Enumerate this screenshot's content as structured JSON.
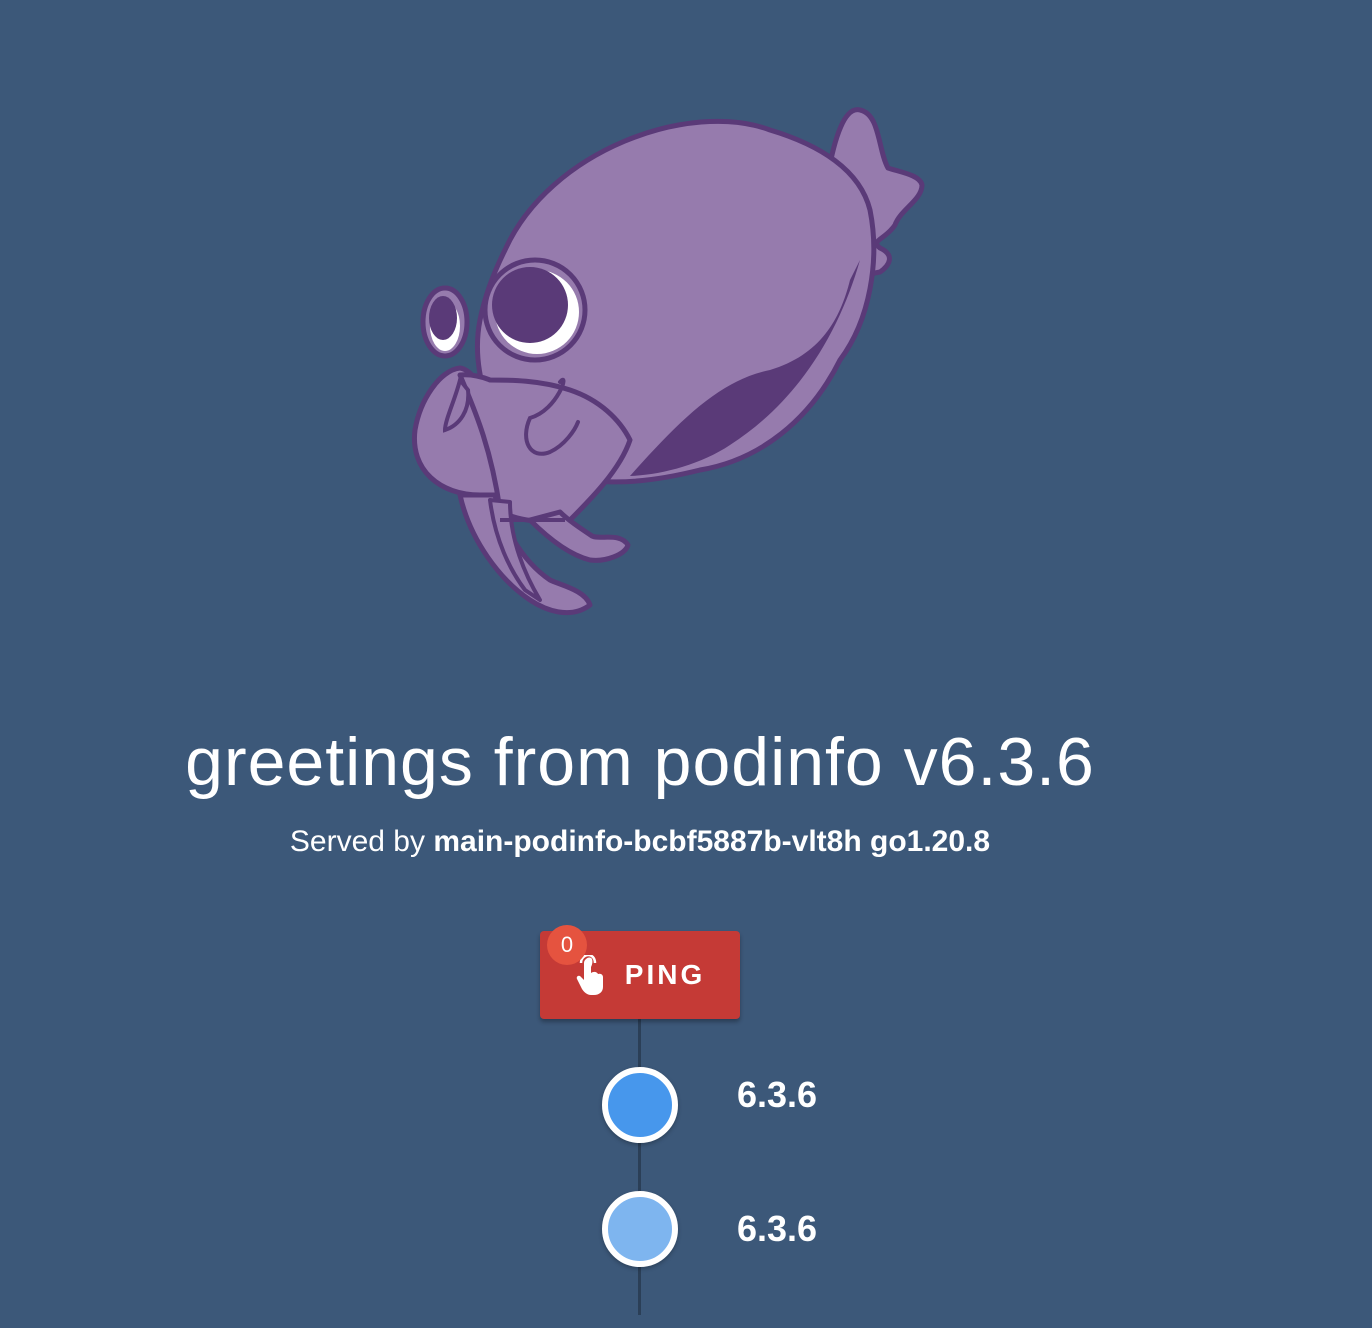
{
  "mascot": {
    "icon": "cuttlefish-mascot-icon",
    "body_color": "#967bad",
    "outline_color": "#5a3a78"
  },
  "greeting": {
    "text": "greetings from podinfo v6.3.6"
  },
  "served_by": {
    "prefix": "Served by",
    "host": "main-podinfo-bcbf5887b-vlt8h go1.20.8"
  },
  "ping": {
    "label": "PING",
    "count": "0",
    "icon": "touch-hand-icon",
    "color": "#c53a36",
    "badge_color": "#e5533f"
  },
  "timeline": {
    "items": [
      {
        "text": "6.3.6",
        "color": "#4797ec"
      },
      {
        "text": "6.3.6",
        "color": "#7eb5ef"
      }
    ]
  },
  "background_color": "#3c5879"
}
